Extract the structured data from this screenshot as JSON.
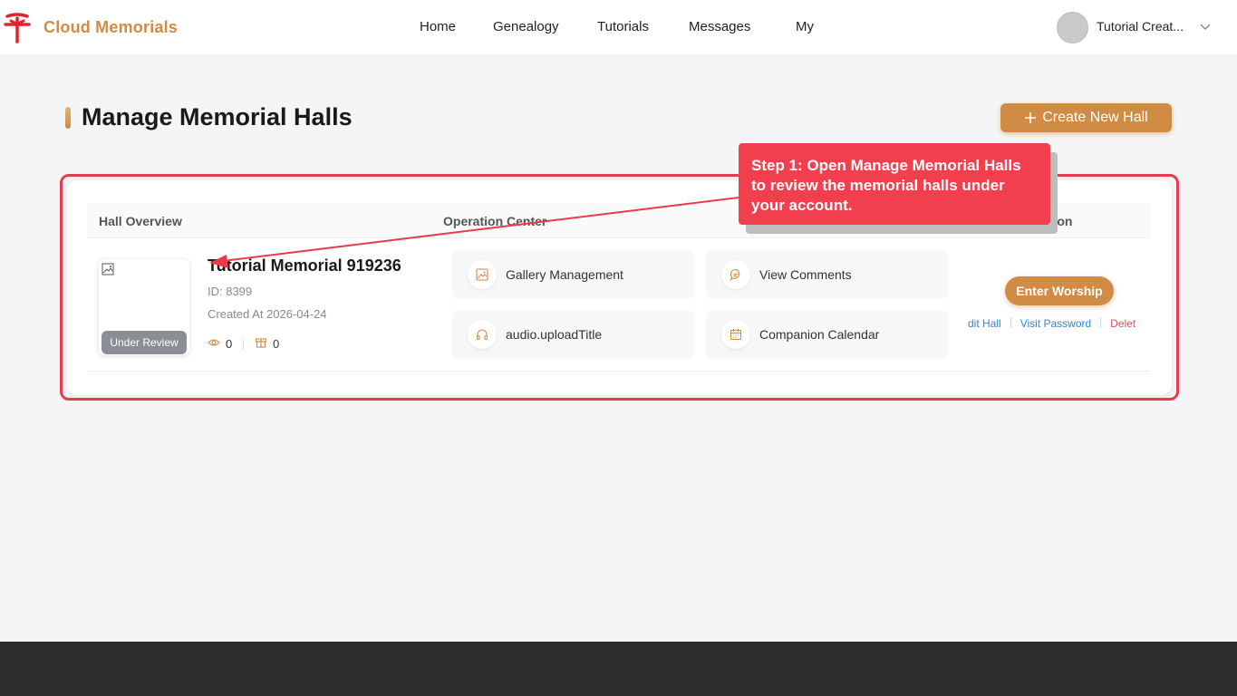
{
  "header": {
    "brand": "Cloud Memorials",
    "nav": [
      "Home",
      "Genealogy",
      "Tutorials",
      "Messages",
      "My"
    ],
    "user_name": "Tutorial Creat..."
  },
  "page": {
    "title": "Manage Memorial Halls",
    "create_button": "Create New Hall"
  },
  "table": {
    "columns": [
      "Hall Overview",
      "Operation Center",
      "ction"
    ],
    "row": {
      "name": "Tutorial Memorial 919236",
      "id_text": "ID: 8399",
      "created_text": "Created At 2026-04-24",
      "status_badge": "Under Review",
      "views": "0",
      "gifts": "0",
      "operations": [
        {
          "label": "Gallery Management",
          "icon": "image-icon"
        },
        {
          "label": "View Comments",
          "icon": "comment-icon"
        },
        {
          "label": "audio.uploadTitle",
          "icon": "headphones-icon"
        },
        {
          "label": "Companion Calendar",
          "icon": "calendar-icon"
        }
      ],
      "enter_button": "Enter Worship",
      "actions": [
        "dit Hall",
        "Visit Password",
        "Delet"
      ]
    }
  },
  "tutorial": {
    "callout": "Step 1: Open Manage Memorial Halls to review the memorial halls under your account."
  },
  "colors": {
    "accent": "#d08b45",
    "highlight": "#ea3a4b",
    "callout": "#f23f4e",
    "link": "#2f86d6",
    "danger": "#e0525c"
  }
}
